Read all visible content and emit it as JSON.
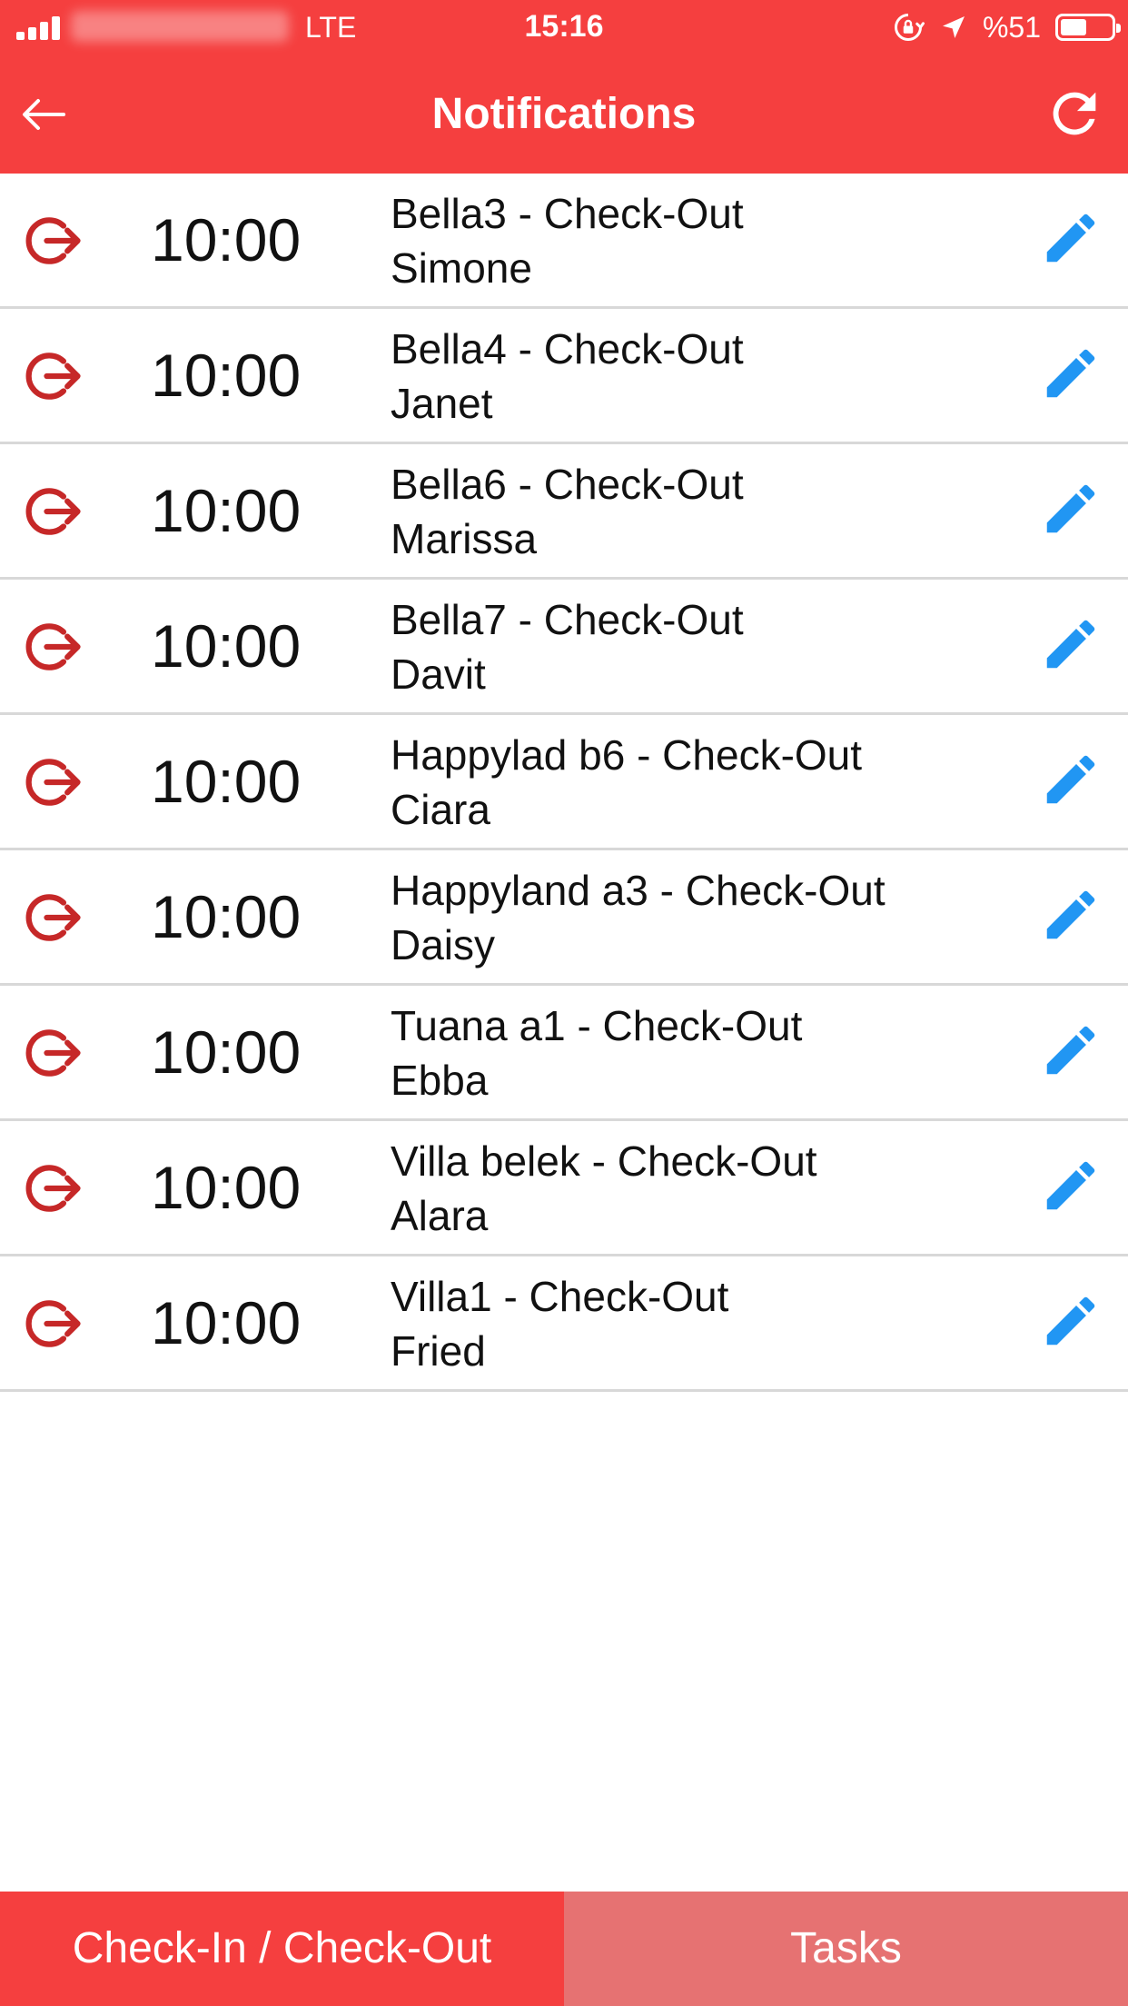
{
  "status_bar": {
    "network": "LTE",
    "time": "15:16",
    "battery_percent": "%51",
    "battery_level": 0.51
  },
  "header": {
    "title": "Notifications"
  },
  "colors": {
    "primary": "#f53f3f",
    "tab_inactive": "#e67272",
    "checkout_icon": "#c62828",
    "edit_icon": "#2196f3"
  },
  "notifications": [
    {
      "time": "10:00",
      "line1": "Bella3 - Check-Out",
      "line2": "Simone"
    },
    {
      "time": "10:00",
      "line1": "Bella4 - Check-Out",
      "line2": "Janet"
    },
    {
      "time": "10:00",
      "line1": "Bella6 - Check-Out",
      "line2": "Marissa"
    },
    {
      "time": "10:00",
      "line1": "Bella7 - Check-Out",
      "line2": "Davit"
    },
    {
      "time": "10:00",
      "line1": "Happylad b6 - Check-Out",
      "line2": "Ciara"
    },
    {
      "time": "10:00",
      "line1": "Happyland a3 - Check-Out",
      "line2": "Daisy"
    },
    {
      "time": "10:00",
      "line1": "Tuana a1 - Check-Out",
      "line2": "Ebba"
    },
    {
      "time": "10:00",
      "line1": "Villa belek - Check-Out",
      "line2": "Alara"
    },
    {
      "time": "10:00",
      "line1": "Villa1 - Check-Out",
      "line2": "Fried"
    }
  ],
  "tabs": [
    {
      "label": "Check-In / Check-Out",
      "active": true
    },
    {
      "label": "Tasks",
      "active": false
    }
  ]
}
